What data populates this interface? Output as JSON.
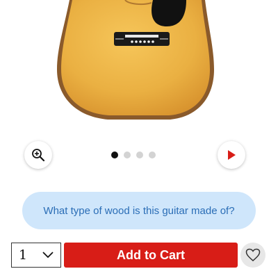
{
  "product": {
    "image_alt": "acoustic-guitar"
  },
  "carousel": {
    "dot_count": 4,
    "active_index": 0
  },
  "suggestion": {
    "text": "What type of wood is this guitar made of?"
  },
  "purchase": {
    "quantity": "1",
    "add_to_cart_label": "Add to Cart"
  },
  "colors": {
    "accent_red": "#d81d17",
    "suggestion_bg": "#cfe6fb",
    "suggestion_text": "#2a6db6"
  },
  "icons": {
    "zoom": "zoom-in-icon",
    "next": "play-arrow-icon",
    "qty": "chevron-down-icon",
    "wishlist": "heart-icon"
  }
}
